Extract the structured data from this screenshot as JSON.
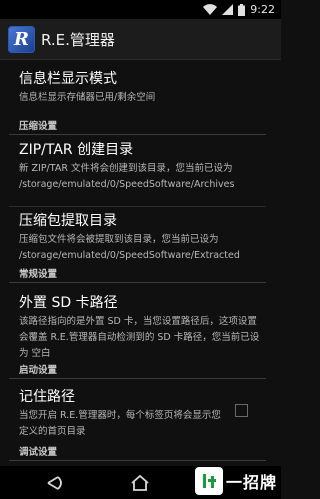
{
  "status": {
    "time": "9:22"
  },
  "app": {
    "title": "R.E.管理器",
    "icon_letter": "R"
  },
  "prefs": {
    "statusbar_mode": {
      "title": "信息栏显示模式",
      "summary": "信息栏显示存储器已用/剩余空间"
    },
    "compress_header": "压缩设置",
    "zip_dir": {
      "title": "ZIP/TAR 创建目录",
      "summary": "新 ZIP/TAR 文件将会创建到该目录，您当前已设为 /storage/emulated/0/SpeedSoftware/Archives"
    },
    "extract_dir": {
      "title": "压缩包提取目录",
      "summary": "压缩包文件将会被提取到该目录，您当前已设为 /storage/emulated/0/SpeedSoftware/Extracted"
    },
    "general_header": "常规设置",
    "sd_path": {
      "title": "外置 SD 卡路径",
      "summary": "该路径指向的是外置 SD 卡，当您设置路径后，这项设置会覆盖 R.E.管理器自动检测到的 SD 卡路径，您当前已设为 空白"
    },
    "startup_header": "启动设置",
    "remember_path": {
      "title": "记住路径",
      "summary": "当您开启 R.E.管理器时，每个标签页将会显示您定义的首页目录",
      "checked": false
    },
    "debug_header": "调试设置"
  },
  "watermark": {
    "text": "一招牌"
  }
}
